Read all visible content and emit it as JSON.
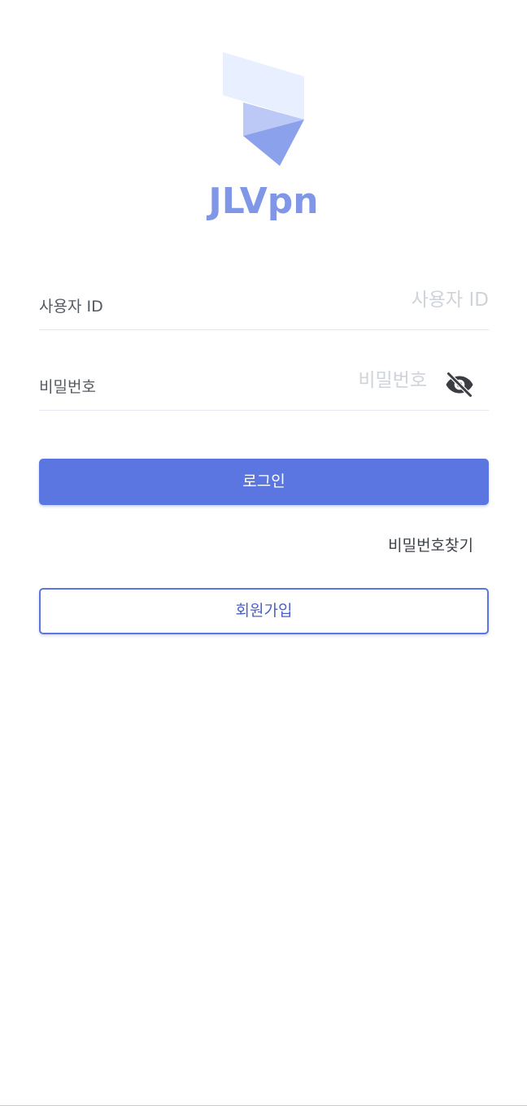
{
  "app": {
    "name": "JLVpn",
    "logo_icon": "jlvpn-logo-icon",
    "colors": {
      "brand": "#7f97e6",
      "primary": "#5b76e1",
      "logo_light": "#e8efff",
      "logo_mid": "#bcc8f5",
      "logo_dark": "#8ca1ec"
    }
  },
  "form": {
    "user_id": {
      "label": "사용자 ID",
      "value": "",
      "placeholder": "사용자 ID"
    },
    "password": {
      "label": "비밀번호",
      "value": "",
      "placeholder": "비밀번호",
      "toggle_icon": "eye-off-icon"
    }
  },
  "actions": {
    "login_label": "로그인",
    "find_password_label": "비밀번호찾기",
    "signup_label": "회원가입"
  }
}
